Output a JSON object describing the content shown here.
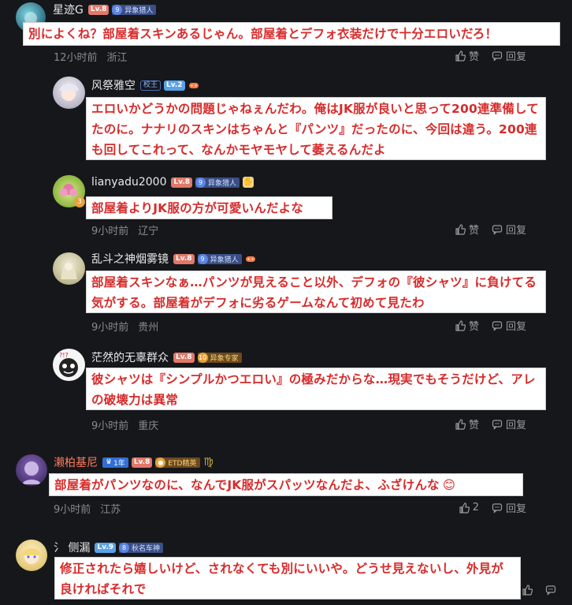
{
  "comments": [
    {
      "user": "星迹G",
      "level": "Lv.8",
      "medal_num": "9",
      "medal": "异象猎人",
      "text": "別によくね？部屋着スキンあるじゃん。部屋着とデフォ衣装だけで十分エロいだろ！",
      "time": "12小时前",
      "location": "浙江",
      "like": "赞",
      "reply": "回复"
    },
    {
      "user": "风祭雅空",
      "badge": "校王",
      "level": "Lv.2",
      "text": "エロいかどうかの問題じゃねぇんだわ。俺はJK服が良いと思って200連準備してたのに。ナナリのスキンはちゃんと『パンツ』だったのに、今回は違う。200連も回してこれって、なんかモヤモヤして萎えるんだよ"
    },
    {
      "user": "lianyadu2000",
      "level": "Lv.8",
      "medal_num": "9",
      "medal": "异象猎人",
      "avatar_num": "3",
      "text": "部屋着よりJK服の方が可愛いんだよな",
      "time": "9小时前",
      "location": "辽宁",
      "like": "赞",
      "reply": "回复"
    },
    {
      "user": "乱斗之神烟雾镜",
      "level": "Lv.8",
      "medal_num": "9",
      "medal": "异象猎人",
      "text": "部屋着スキンなぁ…パンツが見えること以外、デフォの『彼シャツ』に負けてる気がする。部屋着がデフォに劣るゲームなんて初めて見たわ",
      "time": "9小时前",
      "location": "贵州",
      "like": "赞",
      "reply": "回复"
    },
    {
      "user": "茫然的无辜群众",
      "level": "Lv.8",
      "medal_num": "10",
      "medal": "异象专家",
      "text": "彼シャツは『シンプルかつエロい』の極みだからな…現実でもそうだけど、アレの破壊力は異常",
      "time": "9小时前",
      "location": "重庆",
      "like": "赞",
      "reply": "回复"
    },
    {
      "user": "濑柏基尼",
      "year_badge": "1年",
      "level": "Lv.8",
      "medal": "ETD精英",
      "zodiac": "♍",
      "text": "部屋着がパンツなのに、なんでJK服がスパッツなんだよ、ふざけんな",
      "emoji": "😊",
      "time": "9小时前",
      "location": "江苏",
      "like_count": "2",
      "reply": "回复"
    },
    {
      "user": "侧漏",
      "user_prefix": "氵",
      "level": "Lv.9",
      "medal_num": "8",
      "medal": "秋名车神",
      "text": "修正されたら嬉しいけど、されなくても別にいいや。どうせ見えないし、外見が良ければそれで"
    }
  ],
  "colors": {
    "text_red": "#d72b2b",
    "bg": "#16171b",
    "lv": "#e0796a"
  }
}
